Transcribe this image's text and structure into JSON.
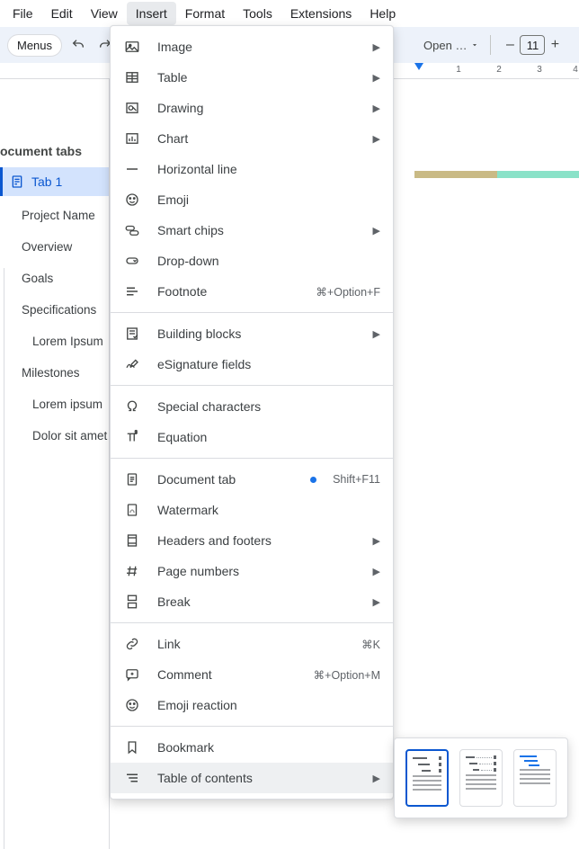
{
  "menubar": {
    "items": [
      "File",
      "Edit",
      "View",
      "Insert",
      "Format",
      "Tools",
      "Extensions",
      "Help"
    ],
    "active_index": 3
  },
  "toolbar": {
    "menus_label": "Menus",
    "font_label": "Open …",
    "font_size": "11"
  },
  "ruler": {
    "labels": [
      "1",
      "2",
      "3",
      "4"
    ]
  },
  "outline": {
    "title": "ocument tabs",
    "active_tab": "Tab 1",
    "headings": [
      {
        "text": "Project Name",
        "level": 1
      },
      {
        "text": "Overview",
        "level": 1
      },
      {
        "text": "Goals",
        "level": 1
      },
      {
        "text": "Specifications",
        "level": 1
      },
      {
        "text": "Lorem Ipsum",
        "level": 2
      },
      {
        "text": "Milestones",
        "level": 1
      },
      {
        "text": "Lorem ipsum",
        "level": 2
      },
      {
        "text": "Dolor sit amet",
        "level": 2
      }
    ]
  },
  "dropdown": {
    "groups": [
      [
        {
          "label": "Image",
          "submenu": true,
          "icon": "image-icon"
        },
        {
          "label": "Table",
          "submenu": true,
          "icon": "table-icon"
        },
        {
          "label": "Drawing",
          "submenu": true,
          "icon": "drawing-icon"
        },
        {
          "label": "Chart",
          "submenu": true,
          "icon": "chart-icon"
        },
        {
          "label": "Horizontal line",
          "submenu": false,
          "icon": "hline-icon"
        },
        {
          "label": "Emoji",
          "submenu": false,
          "icon": "emoji-icon"
        },
        {
          "label": "Smart chips",
          "submenu": true,
          "icon": "chips-icon"
        },
        {
          "label": "Drop-down",
          "submenu": false,
          "icon": "dropdown-icon"
        },
        {
          "label": "Footnote",
          "submenu": false,
          "icon": "footnote-icon",
          "shortcut": "⌘+Option+F"
        }
      ],
      [
        {
          "label": "Building blocks",
          "submenu": true,
          "icon": "blocks-icon"
        },
        {
          "label": "eSignature fields",
          "submenu": false,
          "icon": "esign-icon"
        }
      ],
      [
        {
          "label": "Special characters",
          "submenu": false,
          "icon": "omega-icon"
        },
        {
          "label": "Equation",
          "submenu": false,
          "icon": "pi-icon"
        }
      ],
      [
        {
          "label": "Document tab",
          "submenu": false,
          "icon": "doctab-icon",
          "dot": true,
          "shortcut": "Shift+F11"
        },
        {
          "label": "Watermark",
          "submenu": false,
          "icon": "watermark-icon"
        },
        {
          "label": "Headers and footers",
          "submenu": true,
          "icon": "hf-icon"
        },
        {
          "label": "Page numbers",
          "submenu": true,
          "icon": "hash-icon"
        },
        {
          "label": "Break",
          "submenu": true,
          "icon": "break-icon"
        }
      ],
      [
        {
          "label": "Link",
          "submenu": false,
          "icon": "link-icon",
          "shortcut": "⌘K"
        },
        {
          "label": "Comment",
          "submenu": false,
          "icon": "comment-icon",
          "shortcut": "⌘+Option+M"
        },
        {
          "label": "Emoji reaction",
          "submenu": false,
          "icon": "emoji-icon"
        }
      ],
      [
        {
          "label": "Bookmark",
          "submenu": false,
          "icon": "bookmark-icon"
        },
        {
          "label": "Table of contents",
          "submenu": true,
          "icon": "toc-icon",
          "highlight": true
        }
      ]
    ]
  }
}
